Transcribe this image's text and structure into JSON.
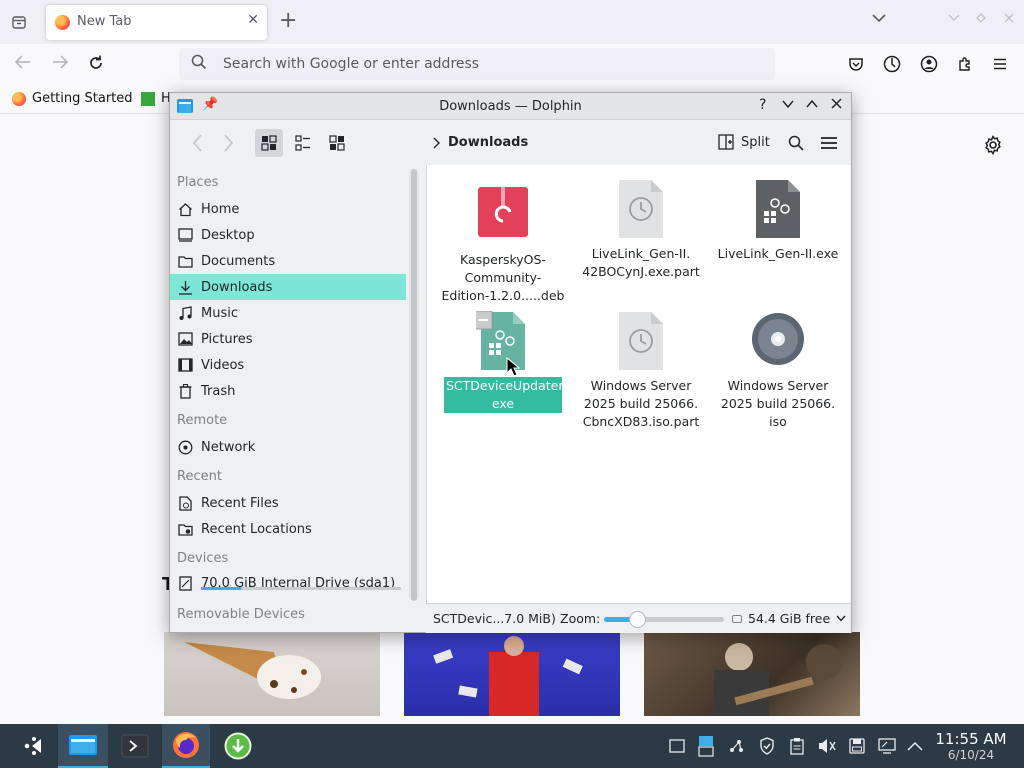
{
  "firefox": {
    "tab_title": "New Tab",
    "url_placeholder": "Search with Google or enter address",
    "bookmarks": [
      "Getting Started",
      "H"
    ],
    "stray_text": "T"
  },
  "dolphin": {
    "window_title": "Downloads — Dolphin",
    "breadcrumb": "Downloads",
    "split_label": "Split",
    "sidebar": {
      "places_header": "Places",
      "places": [
        {
          "label": "Home",
          "icon": "home-icon"
        },
        {
          "label": "Desktop",
          "icon": "desktop-icon"
        },
        {
          "label": "Documents",
          "icon": "documents-icon"
        },
        {
          "label": "Downloads",
          "icon": "downloads-icon",
          "selected": true
        },
        {
          "label": "Music",
          "icon": "music-icon"
        },
        {
          "label": "Pictures",
          "icon": "pictures-icon"
        },
        {
          "label": "Videos",
          "icon": "videos-icon"
        },
        {
          "label": "Trash",
          "icon": "trash-icon"
        }
      ],
      "remote_header": "Remote",
      "remote": [
        {
          "label": "Network",
          "icon": "network-icon"
        }
      ],
      "recent_header": "Recent",
      "recent": [
        {
          "label": "Recent Files",
          "icon": "recent-files-icon"
        },
        {
          "label": "Recent Locations",
          "icon": "recent-locations-icon"
        }
      ],
      "devices_header": "Devices",
      "devices": [
        {
          "label": "70.0 GiB Internal Drive (sda1)",
          "icon": "drive-icon",
          "usage_fraction": 0.2
        }
      ],
      "removable_header": "Removable Devices"
    },
    "files": [
      {
        "name": "KasperskyOS-Community-Edition-1.2.0.....deb",
        "lines": [
          "KasperskyOS-",
          "Community-",
          "Edition-1.2.0.....deb"
        ],
        "icon": "debian-package-icon"
      },
      {
        "name": "LiveLink_Gen-II.42BOCynJ.exe.part",
        "lines": [
          "LiveLink_Gen-II.",
          "42BOCynJ.exe.part"
        ],
        "icon": "partial-download-icon"
      },
      {
        "name": "LiveLink_Gen-II.exe",
        "lines": [
          "LiveLink_Gen-II.exe"
        ],
        "icon": "executable-icon"
      },
      {
        "name": "SCTDeviceUpdater.exe",
        "lines": [
          "SCTDeviceUpdater.",
          "exe"
        ],
        "icon": "executable-icon",
        "selected": true
      },
      {
        "name": "Windows Server 2025 build 25066.CbncXD83.iso.part",
        "lines": [
          "Windows Server",
          "2025 build 25066.",
          "CbncXD83.iso.part"
        ],
        "icon": "partial-download-icon"
      },
      {
        "name": "Windows Server 2025 build 25066.iso",
        "lines": [
          "Windows Server",
          "2025 build 25066.",
          "iso"
        ],
        "icon": "disc-image-icon"
      }
    ],
    "status": {
      "selection": "SCTDevic...7.0 MiB)",
      "zoom_label": "Zoom:",
      "zoom_fraction": 0.28,
      "free_space": "54.4 GiB free"
    }
  },
  "taskbar": {
    "clock_time": "11:55 AM",
    "clock_date": "6/10/24"
  },
  "colors": {
    "selection_highlight": "#7de6d6",
    "file_selection": "#33bca0",
    "accent": "#3daee9",
    "taskbar_bg": "#2b3a44"
  }
}
